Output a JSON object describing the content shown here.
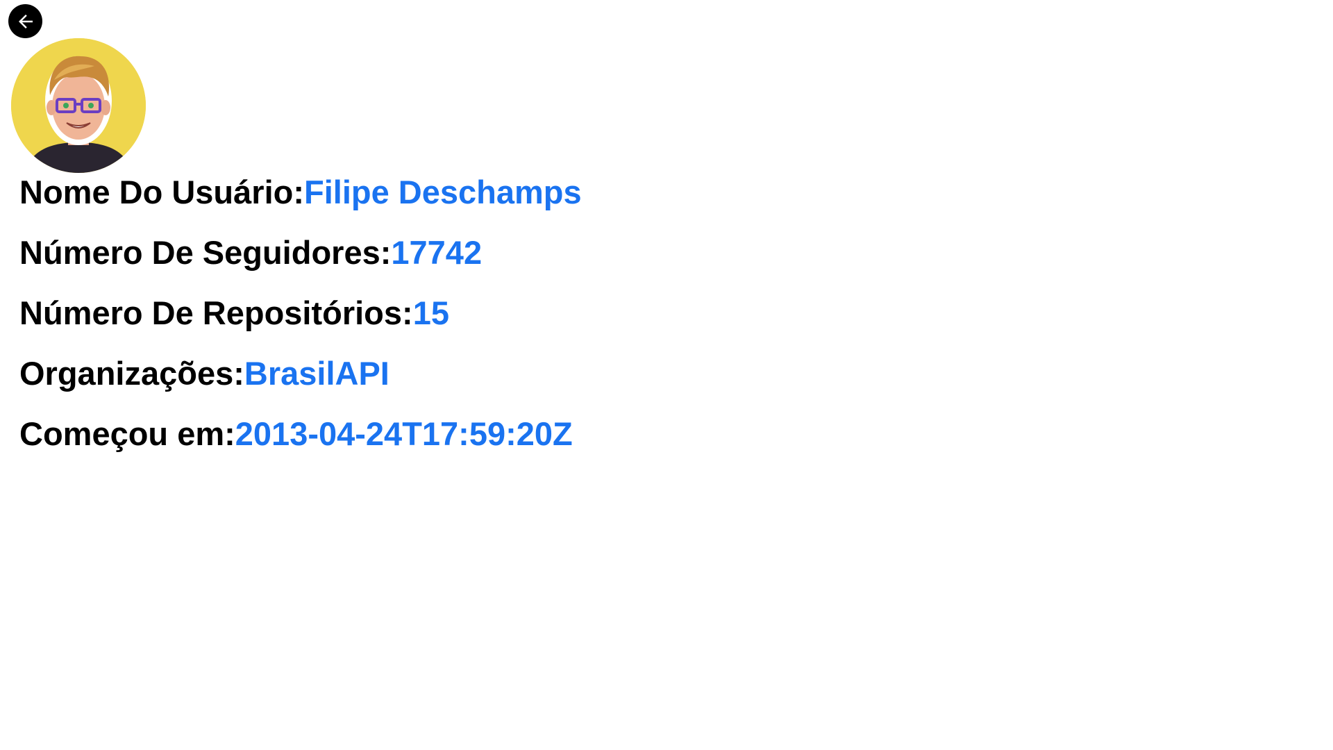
{
  "colors": {
    "label": "#000000",
    "value": "#1a73f0",
    "avatar_background": "#efd64d",
    "back_button": "#000000"
  },
  "back_button": {
    "icon": "arrow-left-icon"
  },
  "avatar": {
    "description_icon": "user-avatar"
  },
  "profile": {
    "name_label": "Nome Do Usuário:",
    "name_value": "Filipe Deschamps",
    "followers_label": "Número De Seguidores:",
    "followers_value": "17742",
    "repos_label": "Número De Repositórios:",
    "repos_value": "15",
    "orgs_label": "Organizações:",
    "orgs_value": "BrasilAPI",
    "started_label": "Começou em:",
    "started_value": "2013-04-24T17:59:20Z"
  }
}
